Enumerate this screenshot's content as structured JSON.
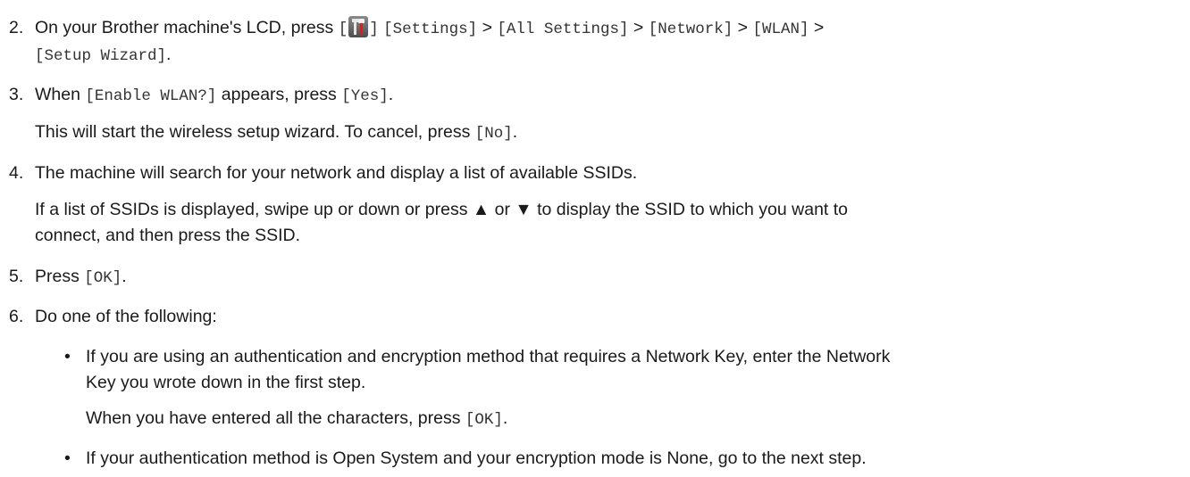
{
  "steps": [
    {
      "number": "2.",
      "line1": {
        "t1": "On your Brother machine's LCD, press ",
        "b_open": "[",
        "b_close": "]",
        "settings": "[Settings]",
        "gt1": " > ",
        "all_settings": "[All Settings]",
        "gt2": " > ",
        "network": "[Network]",
        "gt3": " > ",
        "wlan": "[WLAN]",
        "gt4": " >"
      },
      "line2": {
        "setup_wizard": "[Setup Wizard]",
        "period": "."
      }
    },
    {
      "number": "3.",
      "line1": {
        "t1": "When ",
        "enable_wlan": "[Enable WLAN?]",
        "t2": " appears, press ",
        "yes": "[Yes]",
        "period": "."
      },
      "line2": {
        "t1": "This will start the wireless setup wizard. To cancel, press ",
        "no": "[No]",
        "period": "."
      }
    },
    {
      "number": "4.",
      "line1": "The machine will search for your network and display a list of available SSIDs.",
      "line2": "If a list of SSIDs is displayed, swipe up or down or press ▲ or ▼ to display the SSID to which you want to",
      "line3": "connect, and then press the SSID."
    },
    {
      "number": "5.",
      "line1": {
        "t1": "Press ",
        "ok": "[OK]",
        "period": "."
      }
    },
    {
      "number": "6.",
      "line1": "Do one of the following:",
      "bullets": [
        {
          "mark": "•",
          "line1": "If you are using an authentication and encryption method that requires a Network Key, enter the Network",
          "line2": "Key you wrote down in the first step.",
          "line3": {
            "t1": "When you have entered all the characters, press ",
            "ok": "[OK]",
            "period": "."
          }
        },
        {
          "mark": "•",
          "line1": "If your authentication method is Open System and your encryption mode is None, go to the next step."
        }
      ]
    }
  ],
  "icons": {
    "settings_icon": "settings-tools-icon"
  }
}
